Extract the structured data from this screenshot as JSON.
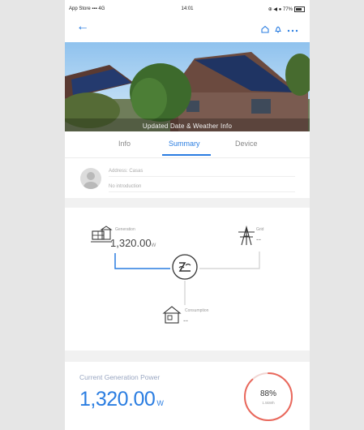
{
  "status": {
    "left": "App Store  ▪▪▪ 4G",
    "time": "14:01",
    "right": "⊕ ◀ ● 77%"
  },
  "header": {
    "back_icon": "back-arrow-icon",
    "icons": [
      "home-icon",
      "bell-icon",
      "more-icon"
    ]
  },
  "hero": {
    "caption": "Updated Date & Weather Info"
  },
  "tabs": [
    {
      "label": "Info",
      "active": false
    },
    {
      "label": "Summary",
      "active": true
    },
    {
      "label": "Device",
      "active": false
    }
  ],
  "profile": {
    "line1": "Address: Casas",
    "line2": "No introduction"
  },
  "flow": {
    "generation_label": "Generation",
    "generation_value": "1,320.00",
    "generation_unit": "W",
    "grid_label": "Grid",
    "grid_value": "--",
    "consumption_label": "Consumption",
    "consumption_value": "--"
  },
  "bottom": {
    "label": "Current Generation Power",
    "value": "1,320.00",
    "unit": "W",
    "gauge_pct": "88%",
    "gauge_sub": "1.5kWh",
    "gauge_fraction": 0.88,
    "gauge_color": "#e9685c"
  },
  "colors": {
    "accent": "#2a7de1",
    "flow_line": "#2a7de1"
  }
}
